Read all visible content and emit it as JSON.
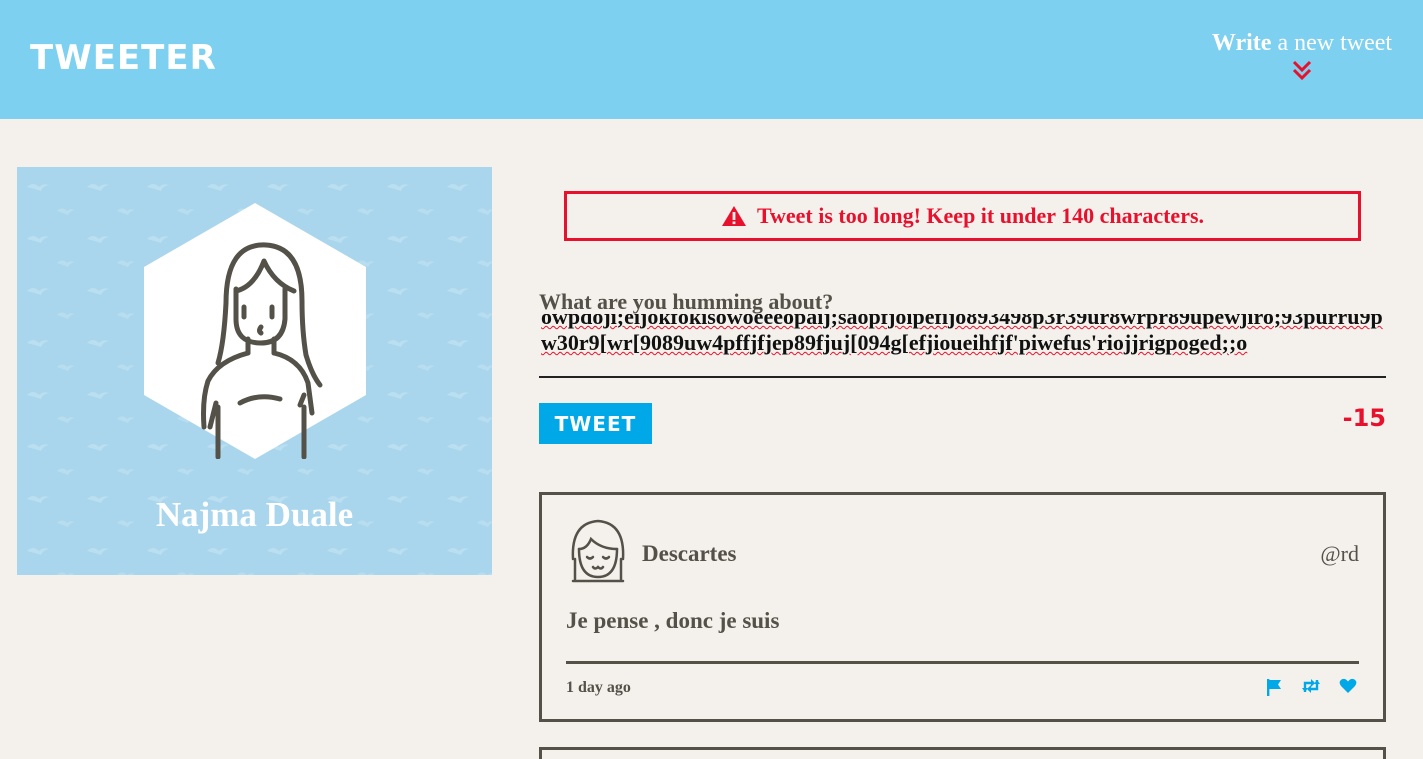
{
  "nav": {
    "brand": "TWEETER",
    "compose_bold": "Write",
    "compose_rest": " a new tweet",
    "chevron_icon": "double-chevron-down-icon"
  },
  "profile": {
    "name": "Najma Duale",
    "avatar_icon": "woman-avatar-icon"
  },
  "compose": {
    "error_message": "Tweet is too long! Keep it under 140 characters.",
    "error_icon": "warning-triangle-icon",
    "label": "What are you humming about?",
    "text": "owpdoji;eijokfokisowoeeeopaij;saopfjoipefijo893498p3r39ur8wrpr89upewjiro;93purru9pw30r9[wr[9089uw4pffjfjep89fjuj[094g[efjioueihfjf'piwefus'riojjrigpoged;;o",
    "button": "Tweet",
    "counter": "-15"
  },
  "tweets": [
    {
      "author": "Descartes",
      "handle": "@rd",
      "content": "Je pense , donc je suis",
      "timestamp": "1 day ago",
      "actions": [
        "flag-icon",
        "retweet-icon",
        "heart-icon"
      ]
    }
  ],
  "colors": {
    "nav_bg": "#7dd0ef",
    "page_bg": "#f4f1ec",
    "profile_bg": "#a9d6ec",
    "accent": "#00a8e8",
    "error": "#e8112d",
    "text": "#545149"
  }
}
